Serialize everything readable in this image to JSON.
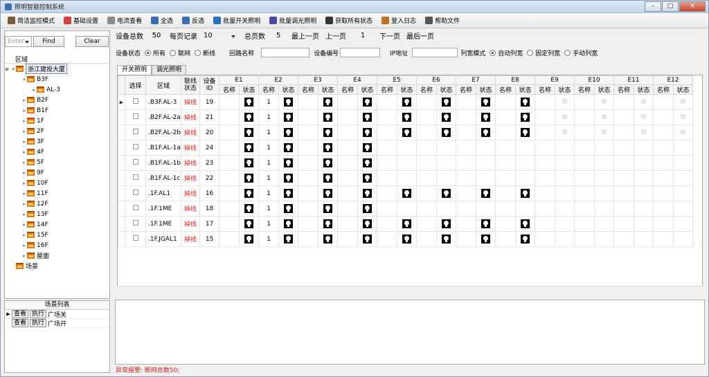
{
  "window": {
    "title": "照明智能控制系统"
  },
  "toolbar": [
    {
      "label": "简洁监控模式",
      "icon": "monitor-icon",
      "color": "#7a5a3a"
    },
    {
      "label": "基础设置",
      "icon": "settings-icon",
      "color": "#d04040"
    },
    {
      "label": "电流查看",
      "icon": "document-icon",
      "color": "#8a8a8a"
    },
    {
      "label": "全选",
      "icon": "select-all-icon",
      "color": "#3b6db5"
    },
    {
      "label": "反选",
      "icon": "invert-select-icon",
      "color": "#3b6db5"
    },
    {
      "label": "批量开关照明",
      "icon": "batch-switch-icon",
      "color": "#2f6fc0"
    },
    {
      "label": "批量调光照明",
      "icon": "batch-dim-icon",
      "color": "#4a4aa0"
    },
    {
      "label": "获取所有状态",
      "icon": "fetch-status-icon",
      "color": "#333333"
    },
    {
      "label": "登入日志",
      "icon": "login-log-icon",
      "color": "#c07020"
    },
    {
      "label": "帮助文件",
      "icon": "help-file-icon",
      "color": "#555555"
    }
  ],
  "search": {
    "placeholder": "Enter",
    "find": "Find",
    "clear": "Clear"
  },
  "tree": {
    "header": "区域",
    "root": "浙江建投大厦",
    "items": [
      {
        "label": "B3F",
        "level": 1,
        "expanded": true
      },
      {
        "label": "AL-3",
        "level": 2,
        "expanded": false
      },
      {
        "label": "B2F",
        "level": 1
      },
      {
        "label": "B1F",
        "level": 1
      },
      {
        "label": "1F",
        "level": 1
      },
      {
        "label": "2F",
        "level": 1
      },
      {
        "label": "3F",
        "level": 1
      },
      {
        "label": "4F",
        "level": 1
      },
      {
        "label": "5F",
        "level": 1
      },
      {
        "label": "9F",
        "level": 1
      },
      {
        "label": "10F",
        "level": 1
      },
      {
        "label": "11F",
        "level": 1
      },
      {
        "label": "12F",
        "level": 1
      },
      {
        "label": "13F",
        "level": 1
      },
      {
        "label": "14F",
        "level": 1
      },
      {
        "label": "15F",
        "level": 1
      },
      {
        "label": "16F",
        "level": 1
      },
      {
        "label": "屋面",
        "level": 1
      }
    ],
    "scene": "场景"
  },
  "scenes": {
    "header": "场景列表",
    "view": "查看",
    "exec": "执行",
    "rows": [
      "广场关",
      "广场开"
    ]
  },
  "pager": {
    "total_label": "设备总数",
    "total": "50",
    "per_page_label": "每页记录",
    "per_page": "10",
    "pages_label": "总页数",
    "pages": "5",
    "prev": "最上一页",
    "prev1": "上一页",
    "current": "1",
    "next": "下一页",
    "last": "最后一页"
  },
  "filter": {
    "status_label": "设备状态",
    "all": "所有",
    "online": "联网",
    "offline": "断线",
    "circuit_label": "回路名称",
    "device_label": "设备编号",
    "ip_label": "IP地址",
    "width_label": "列宽模式",
    "auto": "自动列宽",
    "fixed": "固定列宽",
    "manual": "手动列宽"
  },
  "tabs": [
    "开关照明",
    "调光照明"
  ],
  "grid": {
    "col_select": "选择",
    "col_area": "区域",
    "col_net": "联线状态",
    "col_id": "设备ID",
    "name": "名称",
    "state": "状态",
    "groups": [
      "E1",
      "E2",
      "E3",
      "E4",
      "E5",
      "E6",
      "E7",
      "E8",
      "E9",
      "E10",
      "E11",
      "E12"
    ],
    "rows": [
      {
        "area": ".B3F.AL-3",
        "net": "掉线",
        "id": "19",
        "name": "1",
        "bulbs": 8
      },
      {
        "area": ".B2F.AL-2a",
        "net": "掉线",
        "id": "21",
        "name": "1",
        "bulbs": 8
      },
      {
        "area": ".B2F.AL-2b",
        "net": "掉线",
        "id": "20",
        "name": "1",
        "bulbs": 8
      },
      {
        "area": ".B1F.AL-1a",
        "net": "掉线",
        "id": "24",
        "name": "1",
        "bulbs": 4
      },
      {
        "area": ".B1F.AL-1b",
        "net": "掉线",
        "id": "23",
        "name": "1",
        "bulbs": 4
      },
      {
        "area": ".B1F.AL-1c",
        "net": "掉线",
        "id": "22",
        "name": "1",
        "bulbs": 4
      },
      {
        "area": ".1F.AL1",
        "net": "掉线",
        "id": "16",
        "name": "1",
        "bulbs": 8
      },
      {
        "area": ".1F.1ME",
        "net": "掉线",
        "id": "18",
        "name": "1",
        "bulbs": 4
      },
      {
        "area": ".1F.1ME",
        "net": "掉线",
        "id": "17",
        "name": "1",
        "bulbs": 8
      },
      {
        "area": ".1F.JGAL1",
        "net": "掉线",
        "id": "15",
        "name": "1",
        "bulbs": 8
      }
    ]
  },
  "status": {
    "text": "异常报警:  断网总数50;"
  },
  "colors": {
    "offline": "#e02020",
    "accent": "#1a4e9a"
  }
}
